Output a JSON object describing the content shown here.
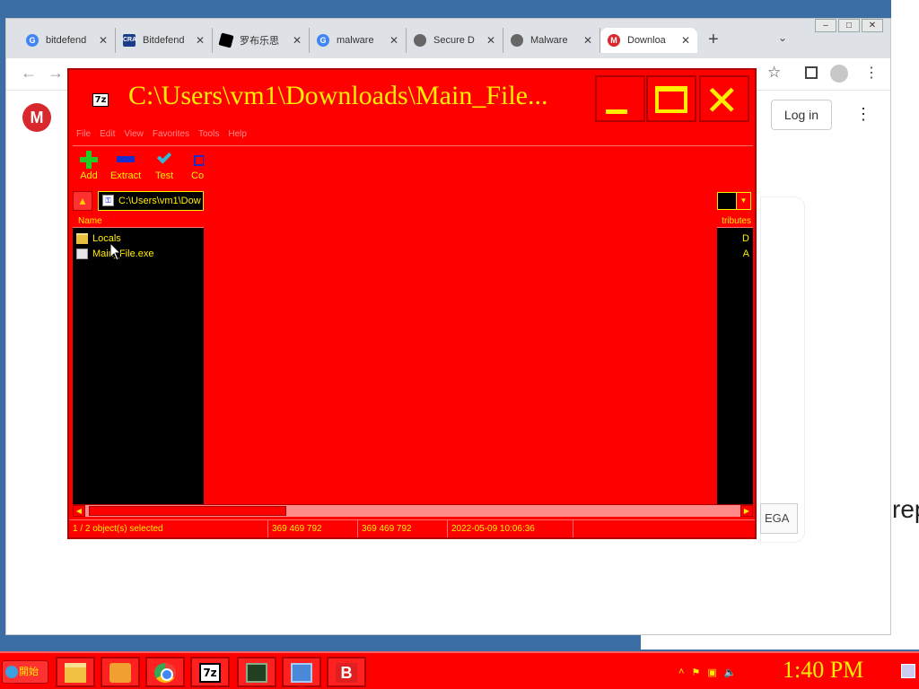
{
  "browser": {
    "tabs": [
      {
        "label": "bitdefend",
        "favicon": "google-icon",
        "color": "#4285f4"
      },
      {
        "label": "Bitdefend",
        "favicon": "cra-icon",
        "color": "#1a3e8a"
      },
      {
        "label": "罗布乐思",
        "favicon": "roblox-icon",
        "color": "#000000"
      },
      {
        "label": "malware",
        "favicon": "google-icon",
        "color": "#4285f4"
      },
      {
        "label": "Secure D",
        "favicon": "globe-icon",
        "color": "#555555"
      },
      {
        "label": "Malware",
        "favicon": "globe-icon",
        "color": "#555555"
      },
      {
        "label": "Downloa",
        "favicon": "mega-icon",
        "color": "#d9272e"
      }
    ],
    "login_label": "Log in",
    "mega_logo": "M",
    "mega_button_label": "EGA",
    "right_text": "rep"
  },
  "zip": {
    "title": "C:\\Users\\vm1\\Downloads\\Main_File...",
    "app_icon": "7z",
    "menu": [
      "File",
      "Edit",
      "View",
      "Favorites",
      "Tools",
      "Help"
    ],
    "toolbar": [
      {
        "label": "Add",
        "icon": "plus-icon"
      },
      {
        "label": "Extract",
        "icon": "minus-icon"
      },
      {
        "label": "Test",
        "icon": "check-icon"
      },
      {
        "label": "Co",
        "icon": "copy-icon"
      }
    ],
    "address": "C:\\Users\\vm1\\Dow",
    "columns": {
      "name": "Name",
      "attributes": "tributes"
    },
    "rows": [
      {
        "name": "Locals",
        "type": "folder",
        "attr": "D"
      },
      {
        "name": "Main_File.exe",
        "type": "file",
        "attr": "A"
      }
    ],
    "status": {
      "selection": "1 / 2 object(s) selected",
      "size": "369 469 792",
      "packed": "369 469 792",
      "modified": "2022-05-09 10:06:36"
    }
  },
  "taskbar": {
    "start_label": "開始",
    "clock": "1:40 PM",
    "apps": [
      "explorer-icon",
      "media-icon",
      "chrome-icon",
      "7zip-icon",
      "task-manager-icon",
      "network-icon",
      "bitdefender-icon"
    ],
    "sevenzip_label": "7z",
    "bitdefender_label": "B"
  },
  "colors": {
    "accent": "#ff0000",
    "text": "#ffee00"
  }
}
